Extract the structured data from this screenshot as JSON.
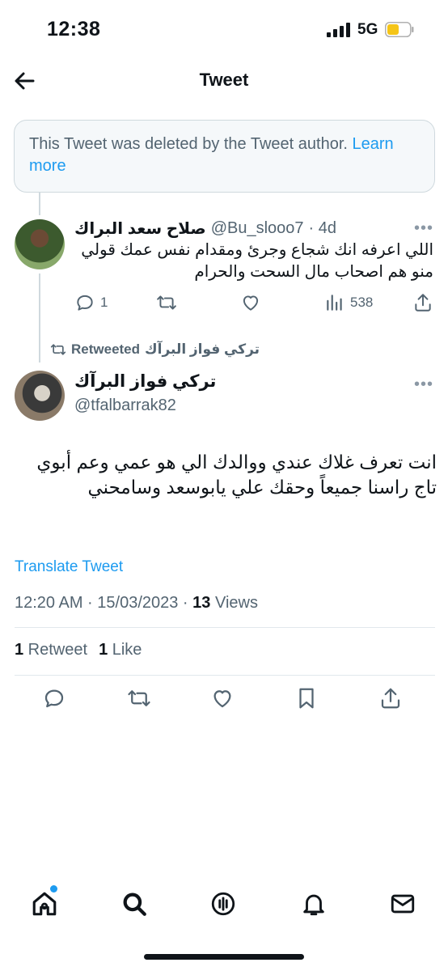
{
  "status_bar": {
    "time": "12:38",
    "network": "5G"
  },
  "header": {
    "title": "Tweet"
  },
  "deleted_notice": {
    "text": "This Tweet was deleted by the Tweet author. ",
    "link": "Learn more"
  },
  "reply": {
    "name": "صلاح سعد البراك",
    "handle": "@Bu_slooo7",
    "time": "· 4d",
    "text": "اللي اعرفه انك شجاع وجرئ ومقدام نفس عمك قولي منو هم اصحاب مال السحت والحرام",
    "replies": "1",
    "views": "538"
  },
  "retweeted_by": {
    "name": "تركي فواز البرآك",
    "label": "Retweeted"
  },
  "tweet": {
    "name": "تركي فواز البرآك",
    "handle": "@tfalbarrak82",
    "text": "انت تعرف غلاك عندي ووالدك الي هو عمي وعم أبوي تاج راسنا جميعاً وحقك علي يابوسعد وسامحني",
    "translate": "Translate Tweet",
    "timestamp": "12:20 AM · 15/03/2023 · ",
    "views_count": "13",
    "views_label": " Views",
    "retweets_count": "1",
    "retweets_label": " Retweet",
    "likes_count": "1",
    "likes_label": " Like"
  },
  "icons": {
    "back": "arrow-left-icon",
    "reply": "comment-icon",
    "retweet": "retweet-icon",
    "like": "heart-icon",
    "views": "bar-chart-icon",
    "share": "share-icon",
    "bookmark": "bookmark-icon",
    "home": "home-icon",
    "search": "search-icon",
    "spaces": "spaces-icon",
    "notifications": "bell-icon",
    "messages": "mail-icon"
  },
  "colors": {
    "accent": "#1d9bf0",
    "secondary_text": "#536471",
    "battery": "#f5c518"
  }
}
